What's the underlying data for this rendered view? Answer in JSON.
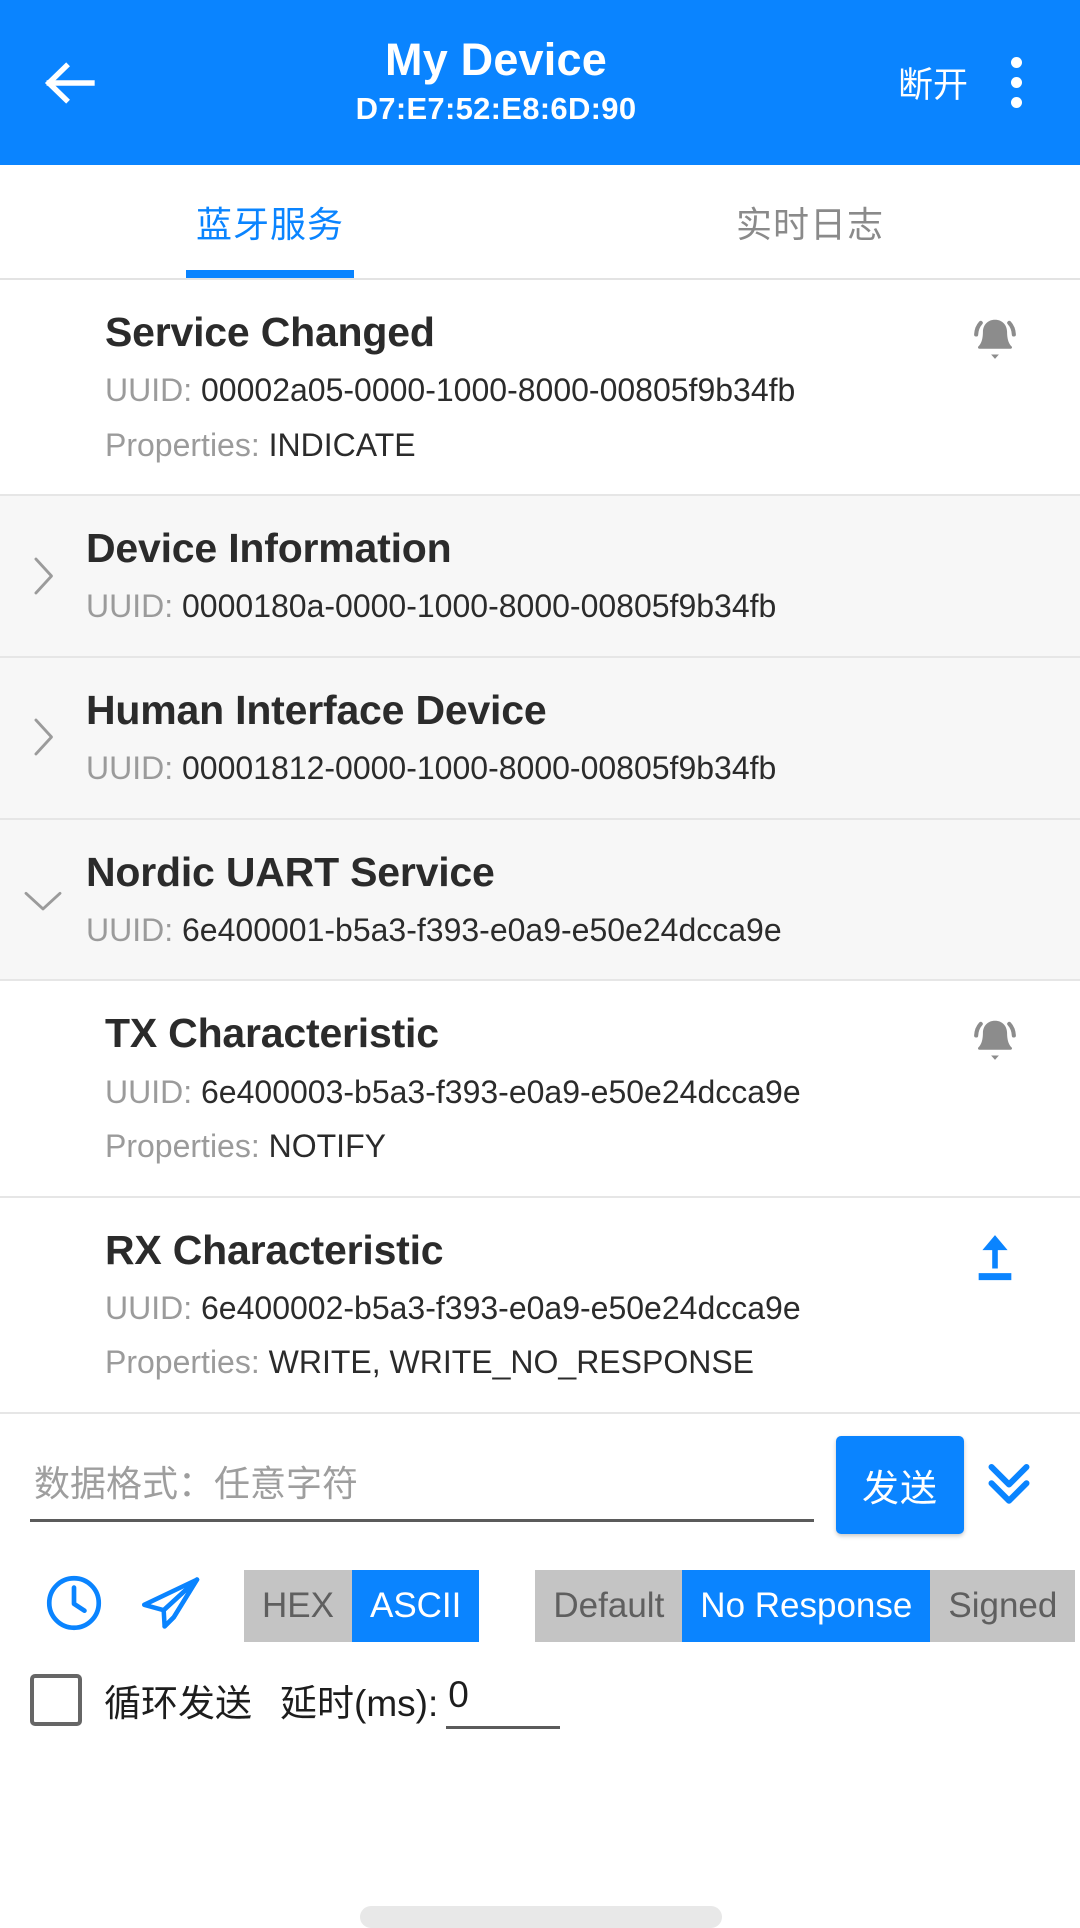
{
  "appbar": {
    "back_icon": "arrow-left-icon",
    "title": "My Device",
    "subtitle": "D7:E7:52:E8:6D:90",
    "disconnect_label": "断开",
    "overflow_icon": "more-vertical-icon",
    "background_color": "#0a84ff"
  },
  "tabs": [
    {
      "label": "蓝牙服务",
      "active": true
    },
    {
      "label": "实时日志",
      "active": false
    }
  ],
  "accent_color": "#0a84ff",
  "list": [
    {
      "kind": "characteristic",
      "title": "Service Changed",
      "uuid_label": "UUID:",
      "uuid": "00002a05-0000-1000-8000-00805f9b34fb",
      "props_label": "Properties:",
      "props": "INDICATE",
      "action_icon": "bell-notify-icon"
    },
    {
      "kind": "service",
      "expanded": false,
      "chevron_icon": "chevron-right-icon",
      "title": "Device Information",
      "uuid_label": "UUID:",
      "uuid": "0000180a-0000-1000-8000-00805f9b34fb"
    },
    {
      "kind": "service",
      "expanded": false,
      "chevron_icon": "chevron-right-icon",
      "title": "Human Interface Device",
      "uuid_label": "UUID:",
      "uuid": "00001812-0000-1000-8000-00805f9b34fb"
    },
    {
      "kind": "service",
      "expanded": true,
      "chevron_icon": "chevron-down-icon",
      "title": "Nordic UART Service",
      "uuid_label": "UUID:",
      "uuid": "6e400001-b5a3-f393-e0a9-e50e24dcca9e"
    },
    {
      "kind": "characteristic",
      "title": "TX Characteristic",
      "uuid_label": "UUID:",
      "uuid": "6e400003-b5a3-f393-e0a9-e50e24dcca9e",
      "props_label": "Properties:",
      "props": "NOTIFY",
      "action_icon": "bell-notify-icon"
    },
    {
      "kind": "characteristic",
      "title": "RX Characteristic",
      "uuid_label": "UUID:",
      "uuid": "6e400002-b5a3-f393-e0a9-e50e24dcca9e",
      "props_label": "Properties:",
      "props": "WRITE, WRITE_NO_RESPONSE",
      "action_icon": "upload-arrow-icon"
    }
  ],
  "send_panel": {
    "input_value": "",
    "input_placeholder": "数据格式：任意字符",
    "send_label": "发送",
    "expand_icon": "chevrons-down-icon",
    "history_icon": "clock-icon",
    "quick_send_icon": "paper-plane-icon",
    "format_toggle": [
      {
        "label": "HEX",
        "active": false
      },
      {
        "label": "ASCII",
        "active": true
      }
    ],
    "write_mode_toggle": [
      {
        "label": "Default",
        "active": false
      },
      {
        "label": "No Response",
        "active": true
      },
      {
        "label": "Signed",
        "active": false
      }
    ],
    "loop_send_label": "循环发送",
    "loop_send_checked": false,
    "delay_label": "延时(ms):",
    "delay_value": "0"
  }
}
